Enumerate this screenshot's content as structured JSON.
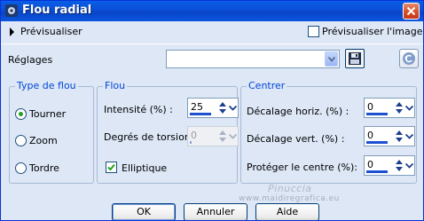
{
  "window": {
    "title": "Flou radial",
    "icon": "app-icon",
    "close_icon": "close-icon"
  },
  "preview": {
    "toggle_label": "Prévisualiser",
    "checkbox_label": "Prévisualiser l'image",
    "checkbox_checked": false
  },
  "presets": {
    "label": "Réglages",
    "value": "",
    "save_icon": "floppy-disk-icon",
    "reset_icon": "reset-arrow-icon"
  },
  "blur_type": {
    "legend": "Type de flou",
    "options": [
      {
        "label": "Tourner",
        "selected": true
      },
      {
        "label": "Zoom",
        "selected": false
      },
      {
        "label": "Tordre",
        "selected": false
      }
    ]
  },
  "blur": {
    "legend": "Flou",
    "intensity_label": "Intensité (%) :",
    "intensity_value": "25",
    "twist_label": "Degrés de torsion :",
    "twist_value": "0",
    "elliptical_label": "Elliptique",
    "elliptical_checked": true
  },
  "center": {
    "legend": "Centrer",
    "h_offset_label": "Décalage horiz. (%) :",
    "h_offset_value": "0",
    "v_offset_label": "Décalage vert. (%) :",
    "v_offset_value": "0",
    "protect_label": "Protéger le centre (%):",
    "protect_value": "0"
  },
  "buttons": {
    "ok": "OK",
    "cancel": "Annuler",
    "help": "Aide"
  },
  "watermark": {
    "line1": "Pinuccia",
    "line2": "www.maidiregrafica.eu"
  },
  "colors": {
    "title_bar": "#0b56de",
    "group_legend": "#0046d5",
    "radio_dot": "#21a121",
    "check_mark": "#21a121",
    "spin_bar": "#1c50d2"
  }
}
